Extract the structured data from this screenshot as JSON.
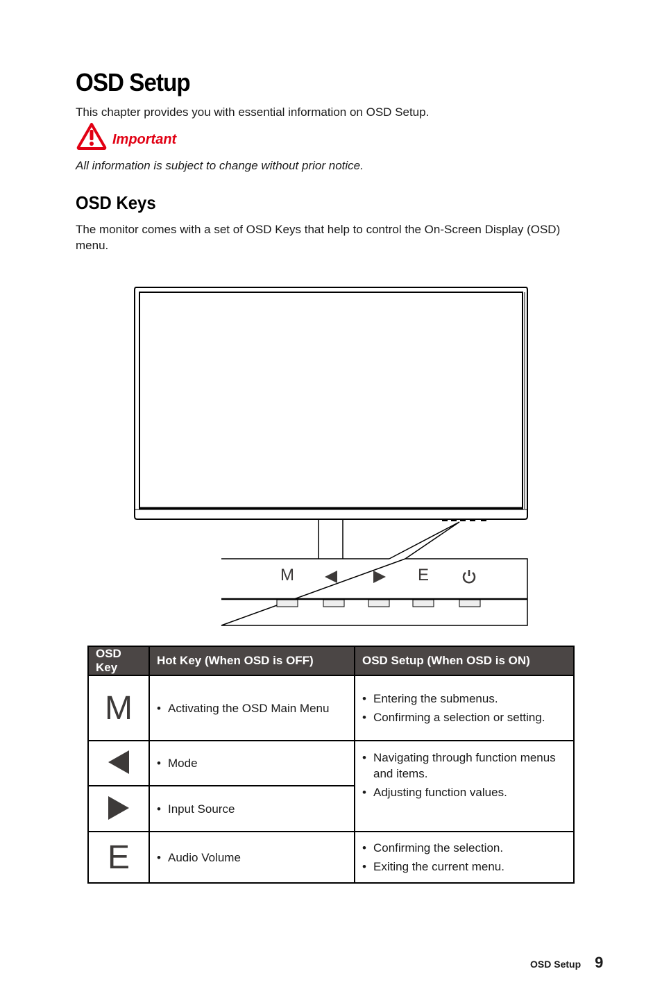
{
  "page": {
    "title": "OSD Setup",
    "intro": "This chapter provides you with essential information on OSD Setup.",
    "important": {
      "icon": "warning-triangle-icon",
      "label": "Important",
      "color": "#e10013",
      "notice": "All information is subject to change without prior notice."
    }
  },
  "osd_keys": {
    "heading": "OSD Keys",
    "description": "The monitor comes with a set of OSD Keys that help to control the On-Screen Display (OSD) menu.",
    "figure": {
      "button_labels": [
        "M",
        "◀",
        "▶",
        "E",
        "⏻"
      ],
      "button_icons": [
        "m-key-icon",
        "left-arrow-icon",
        "right-arrow-icon",
        "e-key-icon",
        "power-icon"
      ]
    }
  },
  "table": {
    "header_bg": "#4b4645",
    "headers": [
      "OSD Key",
      "Hot Key (When OSD is OFF)",
      "OSD Setup (When OSD is ON)"
    ],
    "rows": [
      {
        "key": "M",
        "key_icon": "m-key-icon",
        "hot_key": "Activating the OSD Main Menu",
        "osd_setup": [
          "Entering the submenus.",
          "Confirming a selection or setting."
        ]
      },
      {
        "key": "◀",
        "key_icon": "left-arrow-icon",
        "hot_key": "Mode",
        "osd_setup": [
          "Navigating through function menus and items.",
          "Adjusting function values."
        ]
      },
      {
        "key": "▶",
        "key_icon": "right-arrow-icon",
        "hot_key": "Input Source",
        "osd_setup": []
      },
      {
        "key": "E",
        "key_icon": "e-key-icon",
        "hot_key": "Audio Volume",
        "osd_setup": [
          "Confirming the selection.",
          "Exiting the current menu."
        ]
      }
    ]
  },
  "footer": {
    "section": "OSD Setup",
    "page_number": "9"
  }
}
